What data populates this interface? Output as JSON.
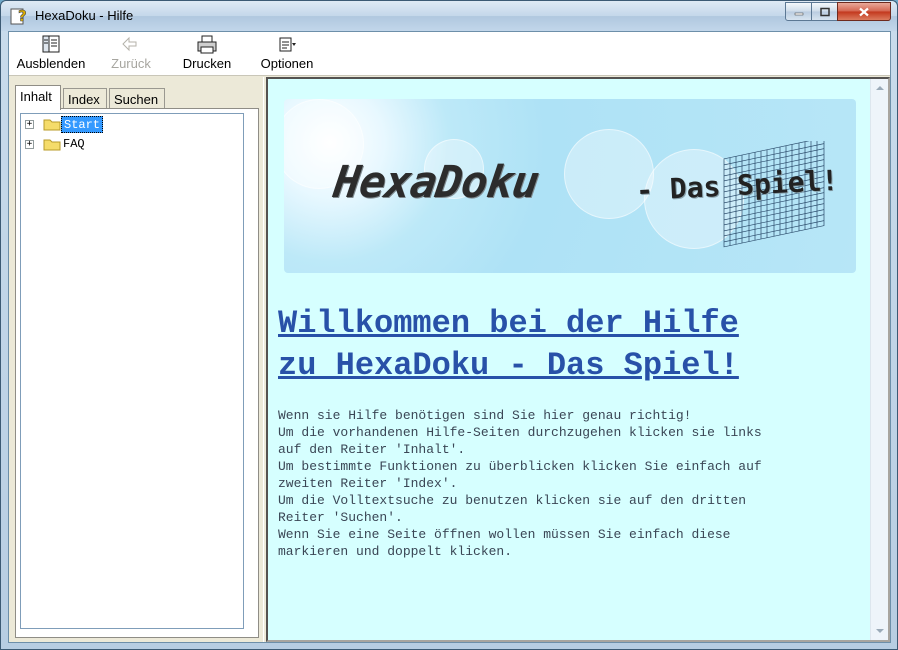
{
  "window": {
    "title": "HexaDoku - Hilfe",
    "icon": "help-question-icon"
  },
  "toolbar": {
    "hide_label": "Ausblenden",
    "back_label": "Zurück",
    "print_label": "Drucken",
    "options_label": "Optionen"
  },
  "tabs": [
    {
      "label": "Inhalt"
    },
    {
      "label": "Index"
    },
    {
      "label": "Suchen"
    }
  ],
  "tree": [
    {
      "label": "Start",
      "selected": true,
      "expander": "+"
    },
    {
      "label": "FAQ",
      "selected": false,
      "expander": "+"
    }
  ],
  "content": {
    "banner_title": "HexaDoku",
    "banner_subtitle": "- Das Spiel!",
    "heading_line1": "Willkommen bei der Hilfe",
    "heading_line2": "zu HexaDoku - Das Spiel!",
    "lines": [
      "Wenn sie Hilfe benötigen sind Sie hier genau richtig!",
      "Um die vorhandenen Hilfe-Seiten durchzugehen klicken sie links",
      "auf den Reiter 'Inhalt'.",
      "Um bestimmte Funktionen zu überblicken klicken Sie einfach auf",
      "zweiten Reiter 'Index'.",
      "Um die Volltextsuche zu benutzen klicken sie auf den dritten",
      "Reiter 'Suchen'.",
      "Wenn Sie eine Seite öffnen wollen müssen Sie einfach diese",
      "markieren und doppelt klicken."
    ]
  },
  "colors": {
    "content_bg": "#d6ffff",
    "heading": "#2851a8",
    "selection": "#3399ff"
  }
}
